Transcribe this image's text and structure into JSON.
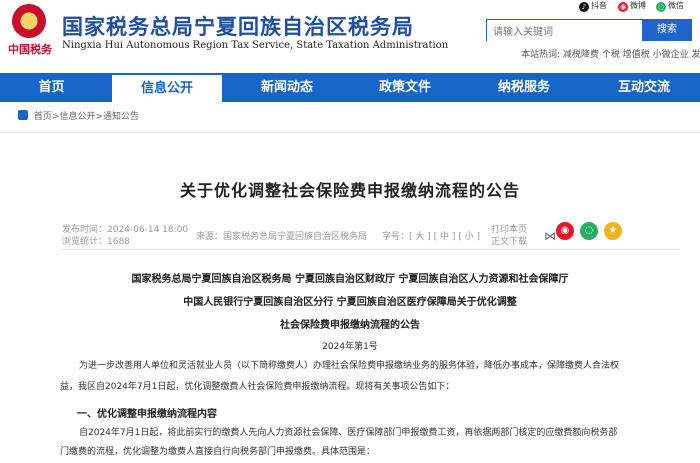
{
  "header": {
    "brand_small": "中国税务",
    "title_zh": "国家税务总局宁夏回族自治区税务局",
    "title_en": "Ningxia Hui Autonomous Region Tax Service, State Taxation Administration",
    "search_placeholder": "请输入关键词",
    "search_button": "搜索",
    "social": [
      {
        "label": "抖音",
        "icon": "douyin-icon",
        "color": "#111111"
      },
      {
        "label": "微博",
        "icon": "weibo-icon",
        "color": "#e6162d"
      },
      {
        "label": "微信",
        "icon": "wechat-icon",
        "color": "#2aae67"
      }
    ],
    "hot_label": "本站热词:",
    "hot_words": [
      "减税降费",
      "个税",
      "增值税",
      "小微企业",
      "发票"
    ]
  },
  "nav": {
    "items": [
      "首页",
      "信息公开",
      "新闻动态",
      "政策文件",
      "纳税服务",
      "互动交流"
    ],
    "active_index": 1
  },
  "breadcrumb": [
    "首页",
    "信息公开",
    "通知公告"
  ],
  "article": {
    "title": "关于优化调整社会保险费申报缴纳流程的公告",
    "published": "发布时间：2024-06-14 18:00",
    "views": "浏览统计：1688",
    "source": "来源：国家税务总局宁夏回族自治区税务局",
    "font_size": "字号：[ 大 ] [ 中 ] [ 小 ]",
    "print": "打印本页",
    "download": "正文下载"
  },
  "document": {
    "head_1": "国家税务总局宁夏回族自治区税务局 宁夏回族自治区财政厅 宁夏回族自治区人力资源和社会保障厅",
    "head_2": "中国人民银行宁夏回族自治区分行 宁夏回族自治区医疗保障局关于优化调整",
    "head_3": "社会保险费申报缴纳流程的公告",
    "doc_number": "2024年第1号",
    "para_1_line_1": "为进一步改善用人单位和灵活就业人员（以下简称缴费人）办理社会保险费申报缴纳业务的服务体验，降低办事成本，保障缴费人合法权",
    "para_1_line_2": "益，我区自2024年7月1日起，优化调整缴费人社会保险费申报缴纳流程。现将有关事项公告如下：",
    "section_1": "一、优化调整申报缴纳流程内容",
    "para_2_line_1": "自2024年7月1日起，将此前实行的缴费人先向人力资源社会保障、医疗保障部门申报缴费工资，再依据两部门核定的应缴费额向税务部",
    "para_2_line_2": "门缴费的流程，优化调整为缴费人直接自行向税务部门申报缴费。具体范围是："
  },
  "colors": {
    "brand_blue": "#1665c7",
    "title_blue": "#1f4ea3",
    "red": "#c8102e"
  }
}
